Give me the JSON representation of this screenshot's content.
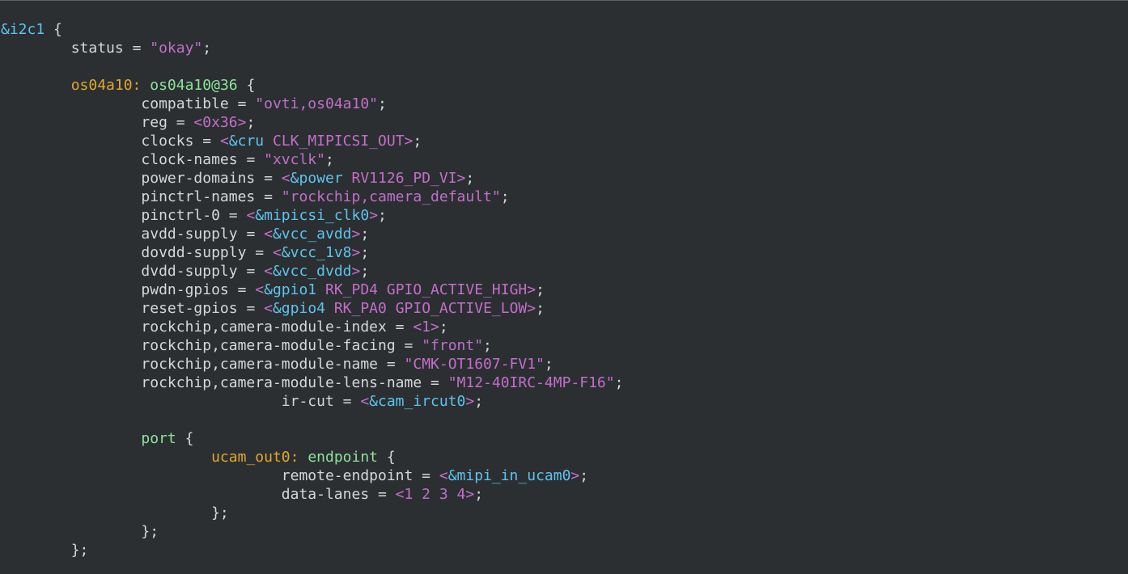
{
  "editor": {
    "language": "devicetree",
    "colors": {
      "background": "#2b2f32",
      "punctuation": "#d5d8d8",
      "reference": "#5ec4ee",
      "string": "#c26fc8",
      "number": "#c26fc8",
      "label": "#e0a82e",
      "node": "#8fe39b",
      "property": "#d5d8d8"
    },
    "lines": [
      [
        {
          "t": "ref",
          "v": "&i2c1"
        },
        {
          "t": "pun",
          "v": " {"
        }
      ],
      [
        {
          "t": "pun",
          "v": "        "
        },
        {
          "t": "prop",
          "v": "status"
        },
        {
          "t": "pun",
          "v": " = "
        },
        {
          "t": "str",
          "v": "\"okay\""
        },
        {
          "t": "pun",
          "v": ";"
        }
      ],
      [],
      [
        {
          "t": "pun",
          "v": "        "
        },
        {
          "t": "lbl",
          "v": "os04a10:"
        },
        {
          "t": "pun",
          "v": " "
        },
        {
          "t": "node",
          "v": "os04a10@36"
        },
        {
          "t": "pun",
          "v": " {"
        }
      ],
      [
        {
          "t": "pun",
          "v": "                "
        },
        {
          "t": "prop",
          "v": "compatible"
        },
        {
          "t": "pun",
          "v": " = "
        },
        {
          "t": "str",
          "v": "\"ovti,os04a10\""
        },
        {
          "t": "pun",
          "v": ";"
        }
      ],
      [
        {
          "t": "pun",
          "v": "                "
        },
        {
          "t": "prop",
          "v": "reg"
        },
        {
          "t": "pun",
          "v": " = "
        },
        {
          "t": "num",
          "v": "<0x36>"
        },
        {
          "t": "pun",
          "v": ";"
        }
      ],
      [
        {
          "t": "pun",
          "v": "                "
        },
        {
          "t": "prop",
          "v": "clocks"
        },
        {
          "t": "pun",
          "v": " = "
        },
        {
          "t": "num",
          "v": "<"
        },
        {
          "t": "ref",
          "v": "&cru"
        },
        {
          "t": "num",
          "v": " CLK_MIPICSI_OUT>"
        },
        {
          "t": "pun",
          "v": ";"
        }
      ],
      [
        {
          "t": "pun",
          "v": "                "
        },
        {
          "t": "prop",
          "v": "clock-names"
        },
        {
          "t": "pun",
          "v": " = "
        },
        {
          "t": "str",
          "v": "\"xvclk\""
        },
        {
          "t": "pun",
          "v": ";"
        }
      ],
      [
        {
          "t": "pun",
          "v": "                "
        },
        {
          "t": "prop",
          "v": "power-domains"
        },
        {
          "t": "pun",
          "v": " = "
        },
        {
          "t": "num",
          "v": "<"
        },
        {
          "t": "ref",
          "v": "&power"
        },
        {
          "t": "num",
          "v": " RV1126_PD_VI>"
        },
        {
          "t": "pun",
          "v": ";"
        }
      ],
      [
        {
          "t": "pun",
          "v": "                "
        },
        {
          "t": "prop",
          "v": "pinctrl-names"
        },
        {
          "t": "pun",
          "v": " = "
        },
        {
          "t": "str",
          "v": "\"rockchip,camera_default\""
        },
        {
          "t": "pun",
          "v": ";"
        }
      ],
      [
        {
          "t": "pun",
          "v": "                "
        },
        {
          "t": "prop",
          "v": "pinctrl-0"
        },
        {
          "t": "pun",
          "v": " = "
        },
        {
          "t": "num",
          "v": "<"
        },
        {
          "t": "ref",
          "v": "&mipicsi_clk0"
        },
        {
          "t": "num",
          "v": ">"
        },
        {
          "t": "pun",
          "v": ";"
        }
      ],
      [
        {
          "t": "pun",
          "v": "                "
        },
        {
          "t": "prop",
          "v": "avdd-supply"
        },
        {
          "t": "pun",
          "v": " = "
        },
        {
          "t": "num",
          "v": "<"
        },
        {
          "t": "ref",
          "v": "&vcc_avdd"
        },
        {
          "t": "num",
          "v": ">"
        },
        {
          "t": "pun",
          "v": ";"
        }
      ],
      [
        {
          "t": "pun",
          "v": "                "
        },
        {
          "t": "prop",
          "v": "dovdd-supply"
        },
        {
          "t": "pun",
          "v": " = "
        },
        {
          "t": "num",
          "v": "<"
        },
        {
          "t": "ref",
          "v": "&vcc_1v8"
        },
        {
          "t": "num",
          "v": ">"
        },
        {
          "t": "pun",
          "v": ";"
        }
      ],
      [
        {
          "t": "pun",
          "v": "                "
        },
        {
          "t": "prop",
          "v": "dvdd-supply"
        },
        {
          "t": "pun",
          "v": " = "
        },
        {
          "t": "num",
          "v": "<"
        },
        {
          "t": "ref",
          "v": "&vcc_dvdd"
        },
        {
          "t": "num",
          "v": ">"
        },
        {
          "t": "pun",
          "v": ";"
        }
      ],
      [
        {
          "t": "pun",
          "v": "                "
        },
        {
          "t": "prop",
          "v": "pwdn-gpios"
        },
        {
          "t": "pun",
          "v": " = "
        },
        {
          "t": "num",
          "v": "<"
        },
        {
          "t": "ref",
          "v": "&gpio1"
        },
        {
          "t": "num",
          "v": " RK_PD4 GPIO_ACTIVE_HIGH>"
        },
        {
          "t": "pun",
          "v": ";"
        }
      ],
      [
        {
          "t": "pun",
          "v": "                "
        },
        {
          "t": "prop",
          "v": "reset-gpios"
        },
        {
          "t": "pun",
          "v": " = "
        },
        {
          "t": "num",
          "v": "<"
        },
        {
          "t": "ref",
          "v": "&gpio4"
        },
        {
          "t": "num",
          "v": " RK_PA0 GPIO_ACTIVE_LOW>"
        },
        {
          "t": "pun",
          "v": ";"
        }
      ],
      [
        {
          "t": "pun",
          "v": "                "
        },
        {
          "t": "prop",
          "v": "rockchip,camera-module-index"
        },
        {
          "t": "pun",
          "v": " = "
        },
        {
          "t": "num",
          "v": "<1>"
        },
        {
          "t": "pun",
          "v": ";"
        }
      ],
      [
        {
          "t": "pun",
          "v": "                "
        },
        {
          "t": "prop",
          "v": "rockchip,camera-module-facing"
        },
        {
          "t": "pun",
          "v": " = "
        },
        {
          "t": "str",
          "v": "\"front\""
        },
        {
          "t": "pun",
          "v": ";"
        }
      ],
      [
        {
          "t": "pun",
          "v": "                "
        },
        {
          "t": "prop",
          "v": "rockchip,camera-module-name"
        },
        {
          "t": "pun",
          "v": " = "
        },
        {
          "t": "str",
          "v": "\"CMK-OT1607-FV1\""
        },
        {
          "t": "pun",
          "v": ";"
        }
      ],
      [
        {
          "t": "pun",
          "v": "                "
        },
        {
          "t": "prop",
          "v": "rockchip,camera-module-lens-name"
        },
        {
          "t": "pun",
          "v": " = "
        },
        {
          "t": "str",
          "v": "\"M12-40IRC-4MP-F16\""
        },
        {
          "t": "pun",
          "v": ";"
        }
      ],
      [
        {
          "t": "pun",
          "v": "                                "
        },
        {
          "t": "prop",
          "v": "ir-cut"
        },
        {
          "t": "pun",
          "v": " = "
        },
        {
          "t": "num",
          "v": "<"
        },
        {
          "t": "ref",
          "v": "&cam_ircut0"
        },
        {
          "t": "num",
          "v": ">"
        },
        {
          "t": "pun",
          "v": ";"
        }
      ],
      [],
      [
        {
          "t": "pun",
          "v": "                "
        },
        {
          "t": "node",
          "v": "port"
        },
        {
          "t": "pun",
          "v": " {"
        }
      ],
      [
        {
          "t": "pun",
          "v": "                        "
        },
        {
          "t": "lbl",
          "v": "ucam_out0:"
        },
        {
          "t": "pun",
          "v": " "
        },
        {
          "t": "node",
          "v": "endpoint"
        },
        {
          "t": "pun",
          "v": " {"
        }
      ],
      [
        {
          "t": "pun",
          "v": "                                "
        },
        {
          "t": "prop",
          "v": "remote-endpoint"
        },
        {
          "t": "pun",
          "v": " = "
        },
        {
          "t": "num",
          "v": "<"
        },
        {
          "t": "ref",
          "v": "&mipi_in_ucam0"
        },
        {
          "t": "num",
          "v": ">"
        },
        {
          "t": "pun",
          "v": ";"
        }
      ],
      [
        {
          "t": "pun",
          "v": "                                "
        },
        {
          "t": "prop",
          "v": "data-lanes"
        },
        {
          "t": "pun",
          "v": " = "
        },
        {
          "t": "num",
          "v": "<1 2 3 4>"
        },
        {
          "t": "pun",
          "v": ";"
        }
      ],
      [
        {
          "t": "pun",
          "v": "                        "
        },
        {
          "t": "pun",
          "v": "};"
        }
      ],
      [
        {
          "t": "pun",
          "v": "                "
        },
        {
          "t": "pun",
          "v": "};"
        }
      ],
      [
        {
          "t": "pun",
          "v": "        "
        },
        {
          "t": "pun",
          "v": "};"
        }
      ]
    ]
  }
}
